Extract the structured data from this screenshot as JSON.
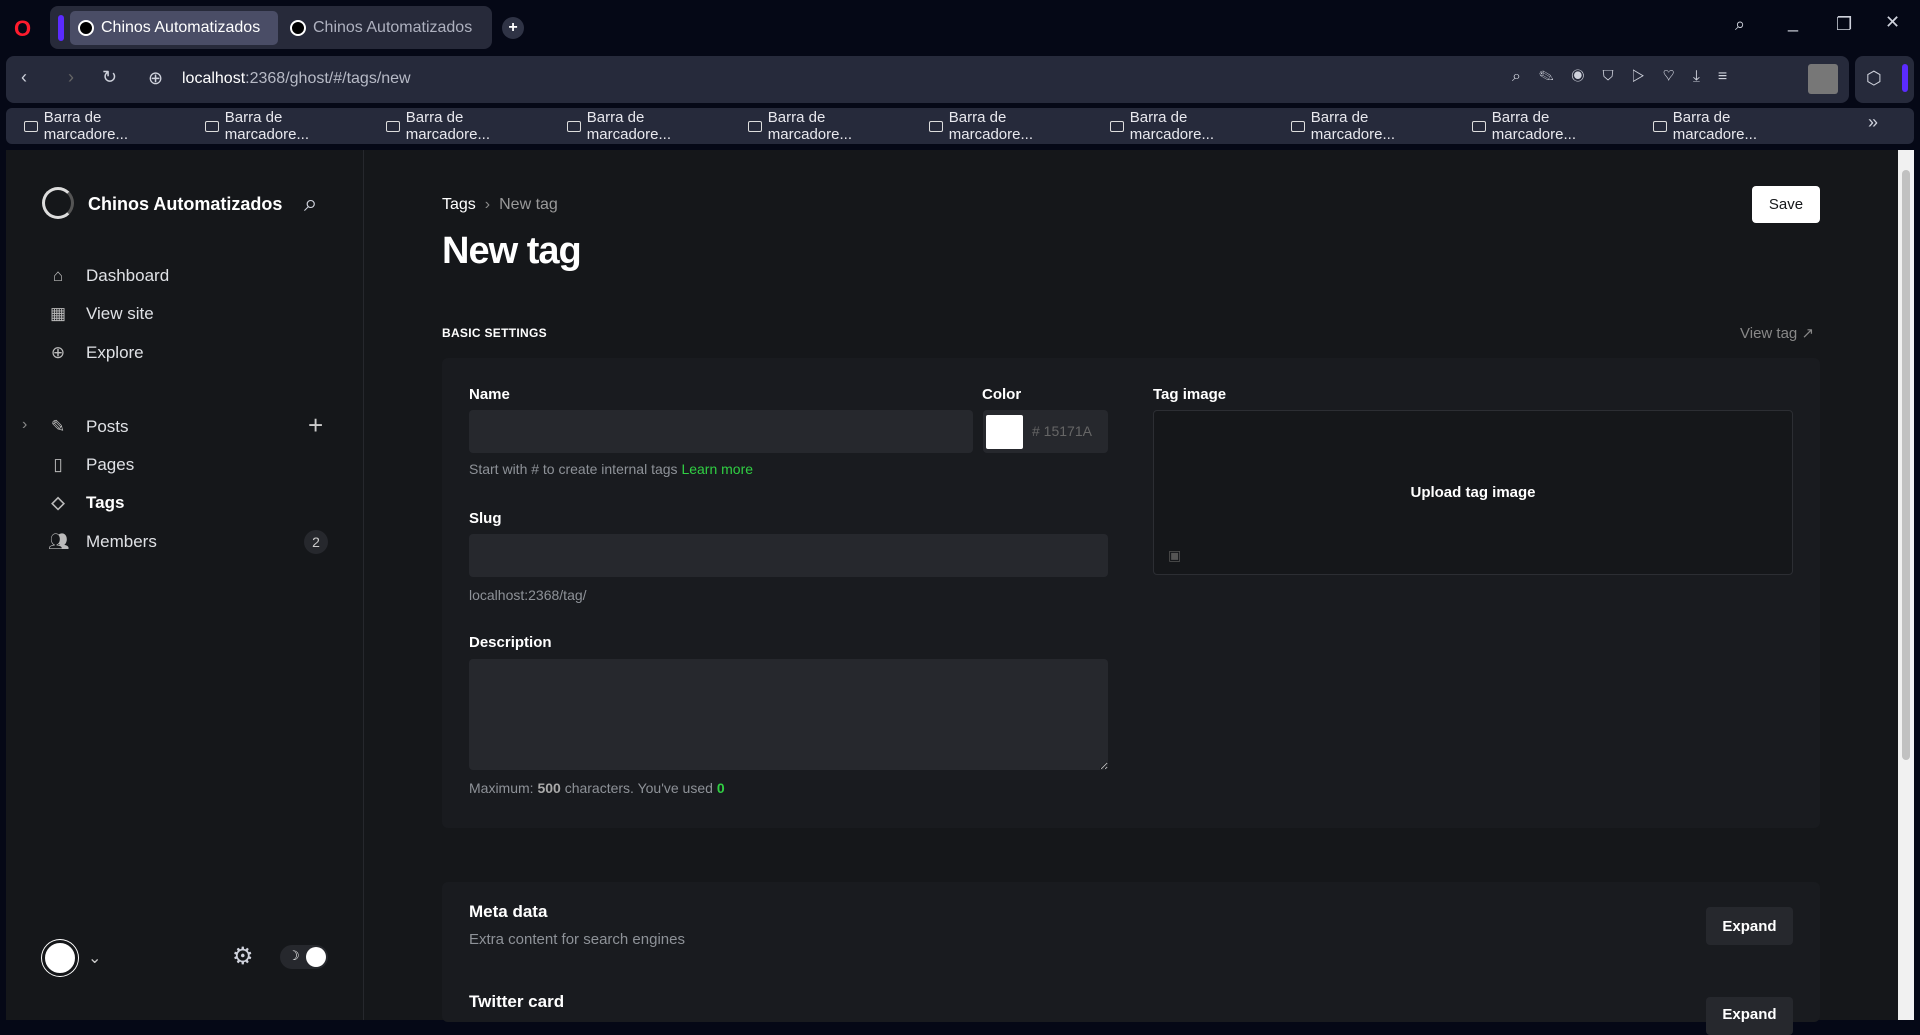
{
  "browser": {
    "tabs": [
      {
        "title": "Chinos Automatizados",
        "active": true
      },
      {
        "title": "Chinos Automatizados",
        "active": false
      }
    ],
    "url_host": "localhost",
    "url_path": ":2368/ghost/#/tags/new",
    "bookmarks": [
      "Barra de marcadore...",
      "Barra de marcadore...",
      "Barra de marcadore...",
      "Barra de marcadore...",
      "Barra de marcadore...",
      "Barra de marcadore...",
      "Barra de marcadore...",
      "Barra de marcadore...",
      "Barra de marcadore...",
      "Barra de marcadore..."
    ]
  },
  "sidebar": {
    "site_title": "Chinos Automatizados",
    "items": [
      {
        "label": "Dashboard"
      },
      {
        "label": "View site"
      },
      {
        "label": "Explore"
      },
      {
        "label": "Posts"
      },
      {
        "label": "Pages"
      },
      {
        "label": "Tags"
      },
      {
        "label": "Members",
        "count": "2"
      }
    ]
  },
  "main": {
    "breadcrumb_parent": "Tags",
    "breadcrumb_current": "New tag",
    "title": "New tag",
    "save_label": "Save",
    "section_title": "BASIC SETTINGS",
    "view_tag": "View tag",
    "name_label": "Name",
    "name_value": "",
    "color_label": "Color",
    "color_value": "# 15171A",
    "name_hint": "Start with # to create internal tags",
    "learn_more": "Learn more",
    "slug_label": "Slug",
    "slug_value": "",
    "slug_url": "localhost:2368/tag/",
    "description_label": "Description",
    "desc_max_prefix": "Maximum: ",
    "desc_max": "500",
    "desc_mid": " characters. You've used ",
    "desc_used": "0",
    "tag_image_label": "Tag image",
    "upload_label": "Upload tag image",
    "meta_title": "Meta data",
    "meta_desc": "Extra content for search engines",
    "expand": "Expand",
    "twitter_title": "Twitter card"
  },
  "colors": {
    "accent": "#30cf43",
    "bg": "#15171a",
    "input": "#26282d"
  }
}
